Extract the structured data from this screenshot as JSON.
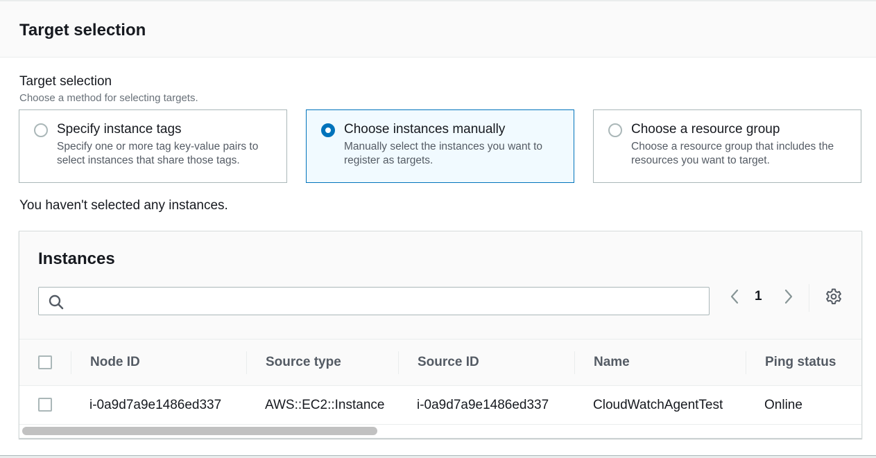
{
  "section": {
    "title": "Target selection"
  },
  "field": {
    "label": "Target selection",
    "description": "Choose a method for selecting targets."
  },
  "options": [
    {
      "title": "Specify instance tags",
      "description": "Specify one or more tag key-value pairs to select instances that share those tags.",
      "selected": false
    },
    {
      "title": "Choose instances manually",
      "description": "Manually select the instances you want to register as targets.",
      "selected": true
    },
    {
      "title": "Choose a resource group",
      "description": "Choose a resource group that includes the resources you want to target.",
      "selected": false
    }
  ],
  "notice": "You haven't selected any instances.",
  "instances": {
    "title": "Instances",
    "search_placeholder": "",
    "page": "1",
    "columns": [
      "Node ID",
      "Source type",
      "Source ID",
      "Name",
      "Ping status"
    ],
    "rows": [
      [
        "i-0a9d7a9e1486ed337",
        "AWS::EC2::Instance",
        "i-0a9d7a9e1486ed337",
        "CloudWatchAgentTest",
        "Online"
      ]
    ]
  },
  "colors": {
    "accent": "#0073bb",
    "text": "#16191f",
    "muted": "#687078"
  }
}
